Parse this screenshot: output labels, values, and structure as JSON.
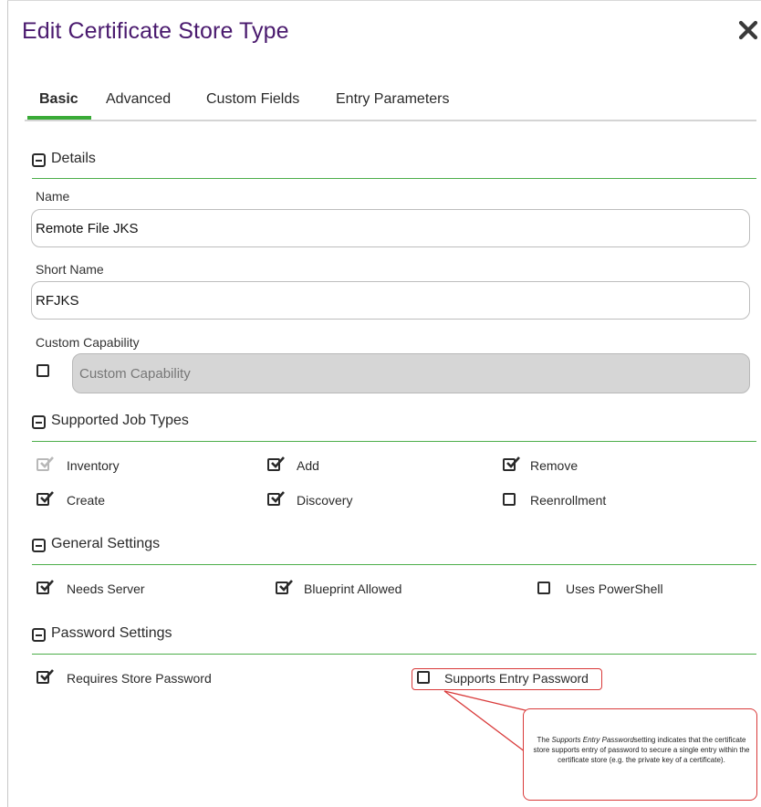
{
  "dialog": {
    "title": "Edit Certificate Store Type"
  },
  "tabs": [
    {
      "label": "Basic",
      "active": true
    },
    {
      "label": "Advanced",
      "active": false
    },
    {
      "label": "Custom Fields",
      "active": false
    },
    {
      "label": "Entry Parameters",
      "active": false
    }
  ],
  "sections": {
    "details": {
      "label": "Details"
    },
    "job_types": {
      "label": "Supported Job Types"
    },
    "general": {
      "label": "General Settings"
    },
    "password": {
      "label": "Password Settings"
    }
  },
  "fields": {
    "name": {
      "label": "Name",
      "value": "Remote File JKS"
    },
    "short_name": {
      "label": "Short Name",
      "value": "RFJKS"
    },
    "custom_capability": {
      "label": "Custom Capability",
      "placeholder": "Custom Capability",
      "checked": false
    }
  },
  "job_types": [
    {
      "label": "Inventory",
      "checked": true,
      "disabled": true
    },
    {
      "label": "Add",
      "checked": true
    },
    {
      "label": "Remove",
      "checked": true
    },
    {
      "label": "Create",
      "checked": true
    },
    {
      "label": "Discovery",
      "checked": true
    },
    {
      "label": "Reenrollment",
      "checked": false
    }
  ],
  "general_settings": [
    {
      "label": "Needs Server",
      "checked": true
    },
    {
      "label": "Blueprint Allowed",
      "checked": true
    },
    {
      "label": "Uses PowerShell",
      "checked": false
    }
  ],
  "password_settings": [
    {
      "label": "Requires Store Password",
      "checked": true
    },
    {
      "label": "Supports Entry Password",
      "checked": false
    }
  ],
  "callout": {
    "prefix": "The ",
    "emphasis": "Supports Entry Password",
    "body": "setting indicates that the certificate store supports entry of password to secure a single entry within the certificate store (e.g. the private key of a certificate)."
  },
  "colors": {
    "title": "#4a1a6e",
    "accent_green": "#3aab37",
    "callout_red": "#d93a3a"
  }
}
